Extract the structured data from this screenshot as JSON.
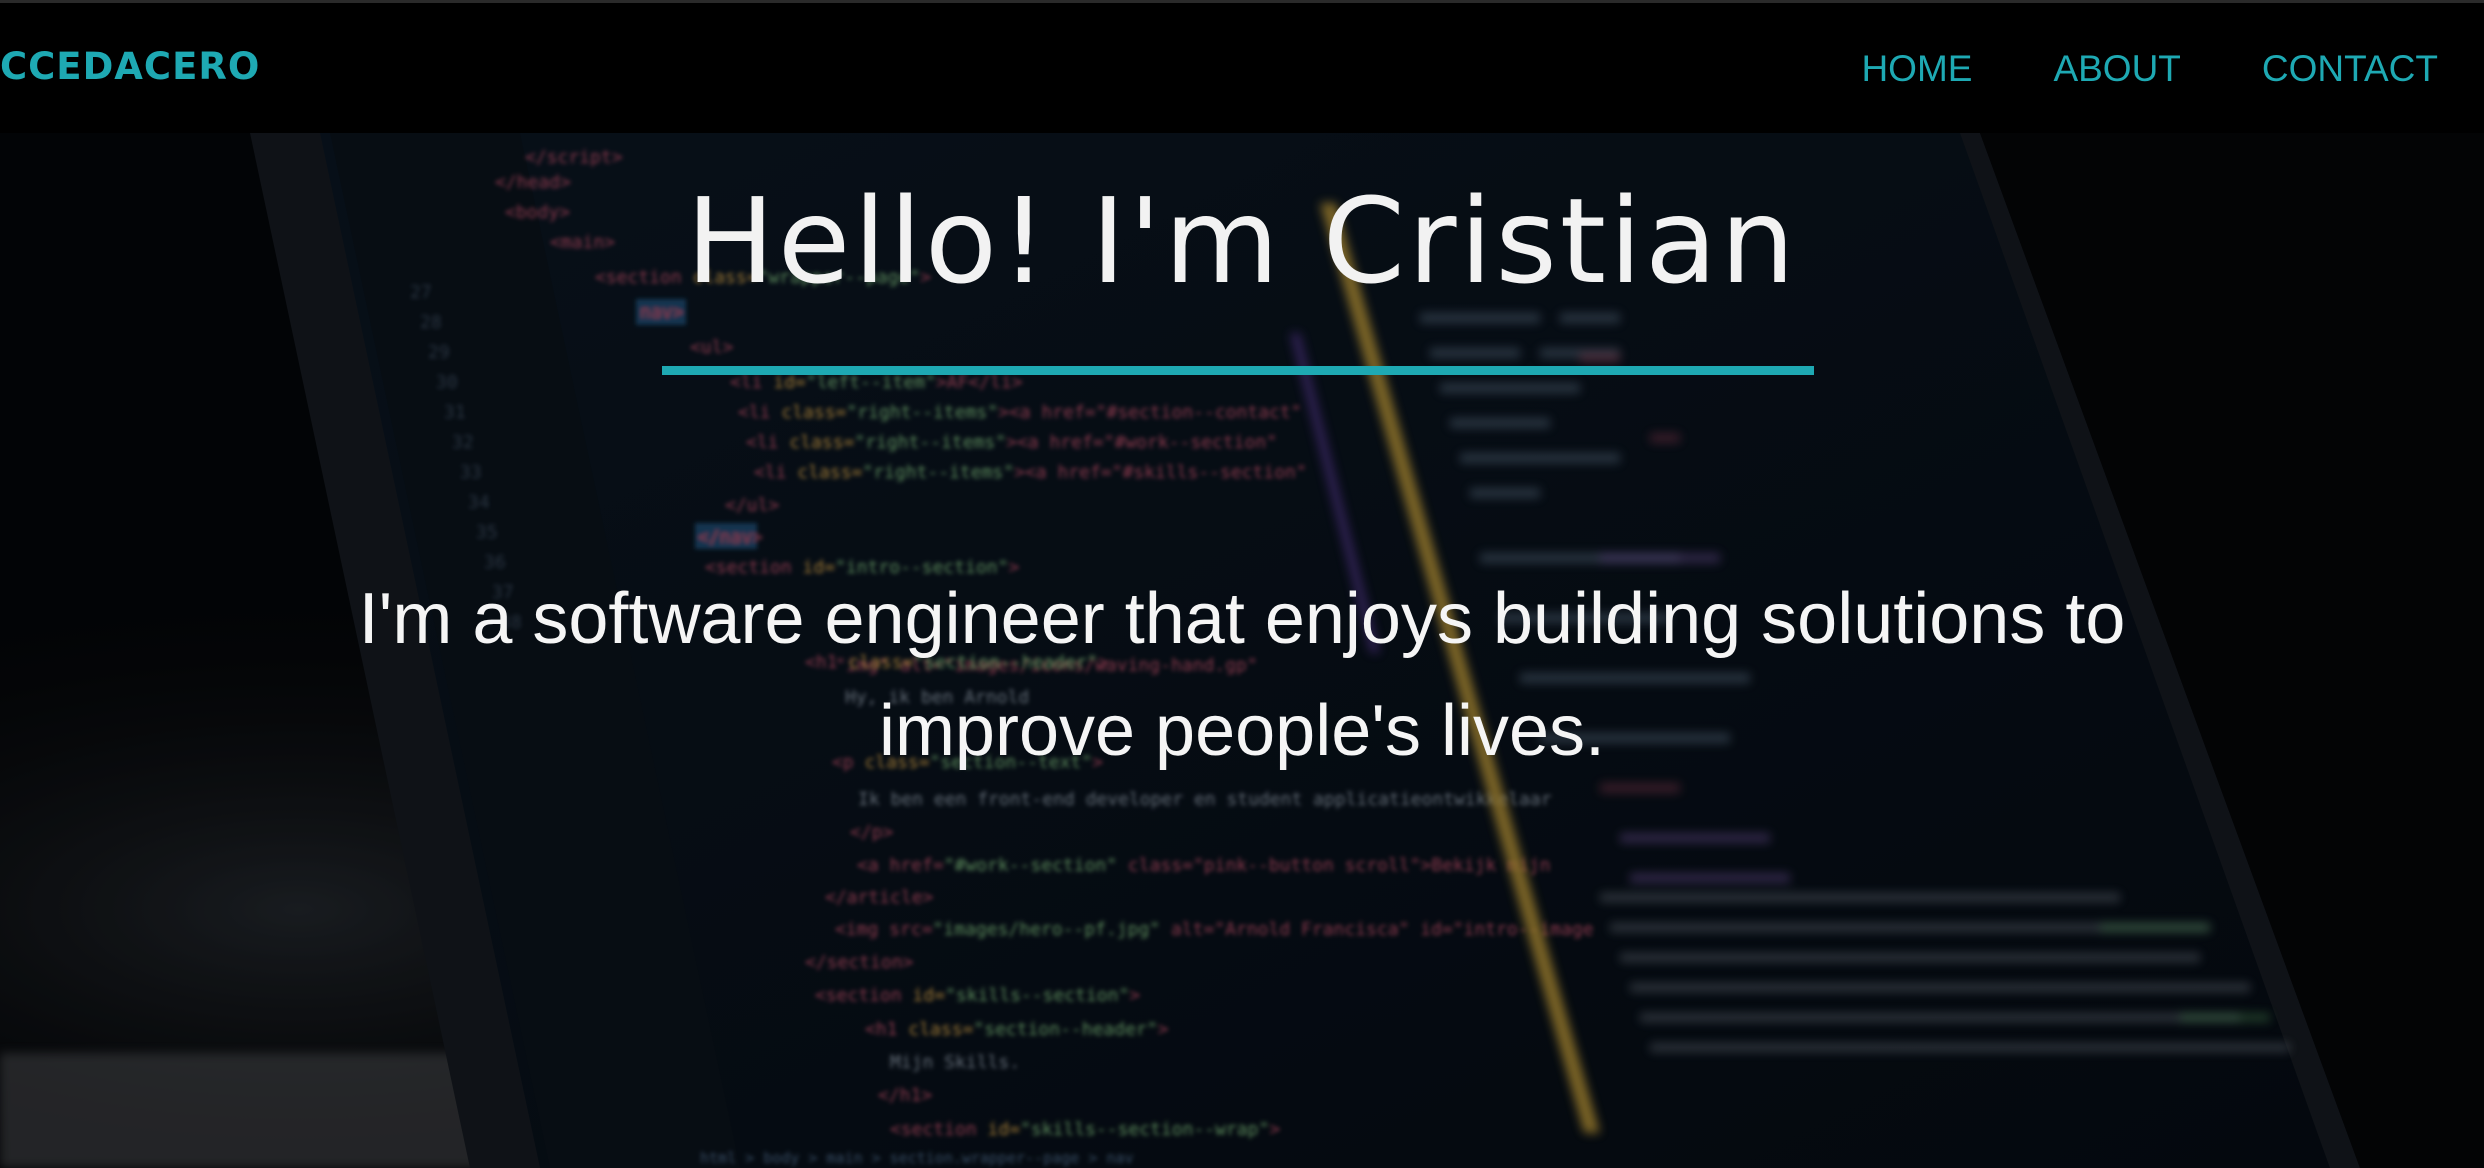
{
  "nav": {
    "brand": "CCEDACERO",
    "links": [
      "HOME",
      "ABOUT",
      "CONTACT"
    ]
  },
  "hero": {
    "title": "Hello! I'm Cristian",
    "subtitle": "I'm a software engineer that enjoys building solutions to improve people's lives.",
    "background_image": "laptop screen with HTML code"
  },
  "colors": {
    "accent": "#1ea9b3",
    "background": "#000000",
    "text": "#f2f2f2"
  }
}
